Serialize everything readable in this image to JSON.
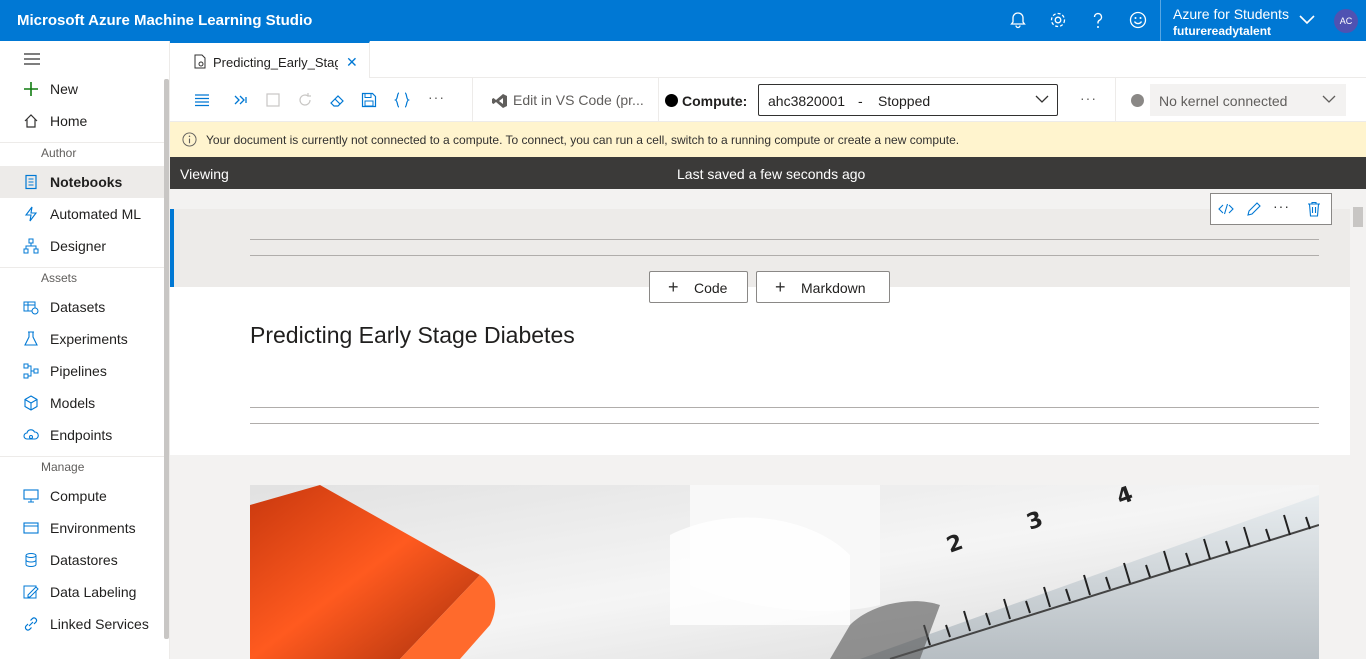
{
  "app": {
    "title": "Microsoft Azure Machine Learning Studio"
  },
  "account": {
    "subscription": "Azure for Students",
    "org": "futurereadytalent",
    "initials": "AC"
  },
  "sidebar": {
    "top_items": [
      {
        "label": "New",
        "icon": "plus-icon"
      },
      {
        "label": "Home",
        "icon": "home-icon"
      }
    ],
    "sections": [
      {
        "title": "Author",
        "items": [
          {
            "label": "Notebooks",
            "icon": "notebook-icon",
            "active": true
          },
          {
            "label": "Automated ML",
            "icon": "automl-icon"
          },
          {
            "label": "Designer",
            "icon": "designer-icon"
          }
        ]
      },
      {
        "title": "Assets",
        "items": [
          {
            "label": "Datasets",
            "icon": "dataset-icon"
          },
          {
            "label": "Experiments",
            "icon": "flask-icon"
          },
          {
            "label": "Pipelines",
            "icon": "pipeline-icon"
          },
          {
            "label": "Models",
            "icon": "cube-icon"
          },
          {
            "label": "Endpoints",
            "icon": "cloud-icon"
          }
        ]
      },
      {
        "title": "Manage",
        "items": [
          {
            "label": "Compute",
            "icon": "monitor-icon"
          },
          {
            "label": "Environments",
            "icon": "environment-icon"
          },
          {
            "label": "Datastores",
            "icon": "database-icon"
          },
          {
            "label": "Data Labeling",
            "icon": "labeling-icon"
          },
          {
            "label": "Linked Services",
            "icon": "link-icon"
          }
        ]
      }
    ]
  },
  "tab": {
    "label": "Predicting_Early_Stag"
  },
  "toolbar": {
    "vscode_label": "Edit in VS Code (pr...",
    "compute_label": "Compute:",
    "compute_name": "ahc3820001",
    "compute_sep": "-",
    "compute_state": "Stopped",
    "kernel_label": "No kernel connected",
    "more": "···"
  },
  "warning": {
    "text": "Your document is currently not connected to a compute. To connect, you can run a cell, switch to a running compute or create a new compute."
  },
  "status": {
    "mode": "Viewing",
    "saved": "Last saved a few seconds ago"
  },
  "notebook": {
    "add_code": "Code",
    "add_markdown": "Markdown",
    "heading": "Predicting Early Stage Diabetes"
  },
  "colors": {
    "brand": "#0078d4",
    "warning_bg": "#fff4ce",
    "status_bg": "#3b3a39"
  }
}
